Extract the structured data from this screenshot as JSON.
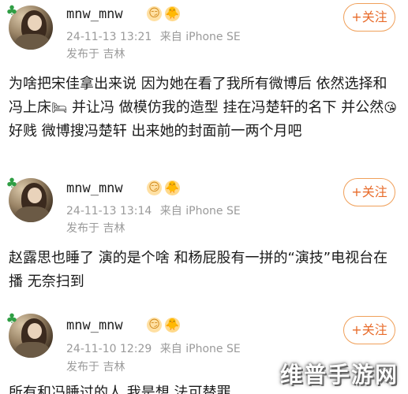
{
  "posts": [
    {
      "username": "mnw_mnw",
      "timestamp": "24-11-13 13:21",
      "device": "来自 iPhone SE",
      "location": "发布于 吉林",
      "follow_label": "+关注",
      "content_parts": [
        "为啥把宋佳拿出来说 因为她在看了我所有微博后 依然选择和冯上床",
        "🛏",
        " 并让冯 做模仿我的造型 挂在冯楚轩的名下 并公然",
        "😘",
        " 好贱 微博搜冯楚轩 出来她的封面前一两个月吧"
      ]
    },
    {
      "username": "mnw_mnw",
      "timestamp": "24-11-13 13:14",
      "device": "来自 iPhone SE",
      "location": "发布于 吉林",
      "follow_label": "+关注",
      "content_parts": [
        "赵露思也睡了 演的是个啥 和杨屁股有一拼的“演技”电视台在播 无奈扫到"
      ]
    },
    {
      "username": "mnw_mnw",
      "timestamp": "24-11-10 12:29",
      "device": "来自 iPhone SE",
      "location": "发布于 吉林",
      "follow_label": "+关注",
      "content_parts": [
        "所有和冯睡过的人 我是想 法可替罪"
      ]
    }
  ],
  "badges": {
    "first": "😏",
    "second": "🐥"
  },
  "icons": {
    "clover": "clover-icon"
  },
  "colors": {
    "follow": "#e86b2a",
    "follow_border": "#f0a05a",
    "meta": "#9a9a9a",
    "clover": "#2f9e44"
  },
  "watermark": "维普手游网"
}
